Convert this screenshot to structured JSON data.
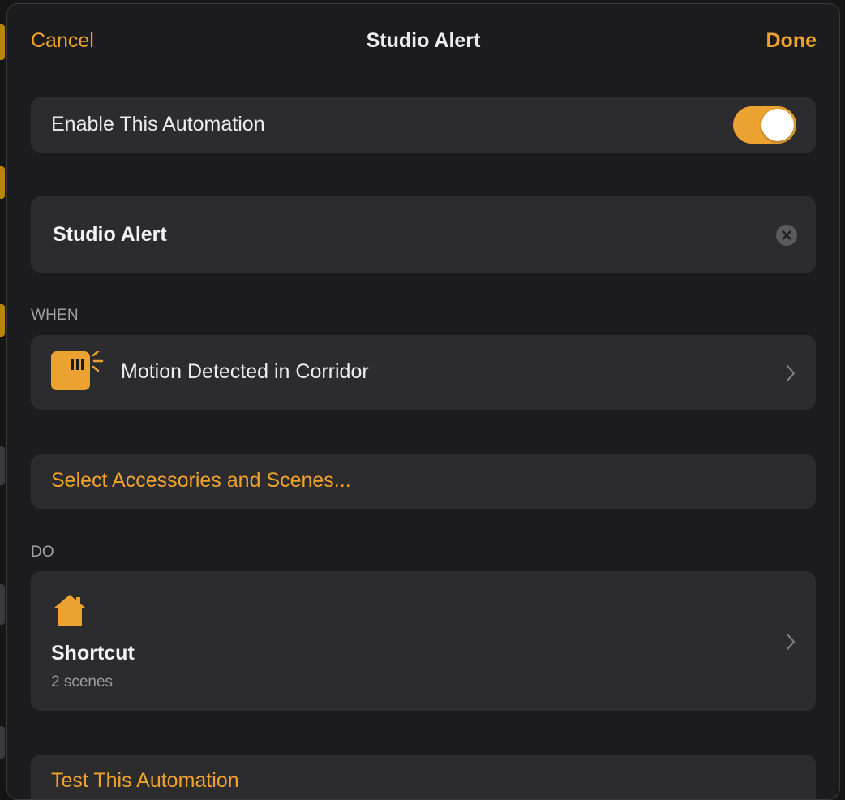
{
  "nav": {
    "cancel_label": "Cancel",
    "title": "Studio Alert",
    "done_label": "Done"
  },
  "enable_row": {
    "label": "Enable This Automation",
    "enabled": true
  },
  "name_field": {
    "value": "Studio Alert",
    "clear_icon": "clear-circle-icon"
  },
  "when_section": {
    "header": "WHEN",
    "trigger_label": "Motion Detected in Corridor",
    "trigger_icon": "motion-sensor-icon"
  },
  "select_row": {
    "label": "Select Accessories and Scenes..."
  },
  "do_section": {
    "header": "DO",
    "action_icon": "home-icon",
    "action_title": "Shortcut",
    "action_subtitle": "2 scenes"
  },
  "test_row": {
    "label": "Test This Automation"
  },
  "colors": {
    "accent": "#f0a32c",
    "sheet_background": "#1c1c1e",
    "card_background": "#2c2c2e",
    "primary_text": "#ebebf0",
    "secondary_text": "#a0a0a6"
  }
}
